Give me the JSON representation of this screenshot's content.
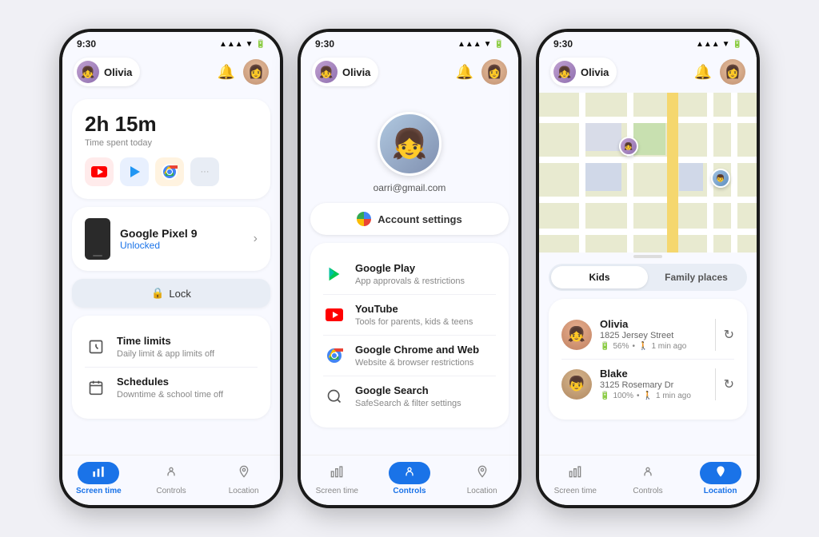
{
  "phone1": {
    "status_time": "9:30",
    "user_name": "Olivia",
    "screen_time": {
      "time": "2h 15m",
      "subtitle": "Time spent today"
    },
    "device": {
      "name": "Google Pixel 9",
      "status": "Unlocked",
      "lock_btn": "Lock"
    },
    "time_limits": {
      "title": "Time limits",
      "sub": "Daily limit & app limits off"
    },
    "schedules": {
      "title": "Schedules",
      "sub": "Downtime & school time off"
    },
    "nav": {
      "screen_time": "Screen time",
      "controls": "Controls",
      "location": "Location"
    }
  },
  "phone2": {
    "status_time": "9:30",
    "user_name": "Olivia",
    "profile_email": "oarri@gmail.com",
    "account_settings": "Account settings",
    "google_play": {
      "title": "Google Play",
      "sub": "App approvals & restrictions"
    },
    "youtube": {
      "title": "YouTube",
      "sub": "Tools for parents, kids & teens"
    },
    "chrome": {
      "title": "Google Chrome and Web",
      "sub": "Website & browser restrictions"
    },
    "search": {
      "title": "Google Search",
      "sub": "SafeSearch & filter settings"
    },
    "nav": {
      "screen_time": "Screen time",
      "controls": "Controls",
      "location": "Location"
    }
  },
  "phone3": {
    "status_time": "9:30",
    "user_name": "Olivia",
    "tabs": {
      "kids": "Kids",
      "family_places": "Family places"
    },
    "olivia": {
      "name": "Olivia",
      "address": "1825 Jersey Street",
      "battery": "56%",
      "time_ago": "1 min ago"
    },
    "blake": {
      "name": "Blake",
      "address": "3125 Rosemary Dr",
      "battery": "100%",
      "time_ago": "1 min ago"
    },
    "nav": {
      "screen_time": "Screen time",
      "controls": "Controls",
      "location": "Location"
    }
  }
}
